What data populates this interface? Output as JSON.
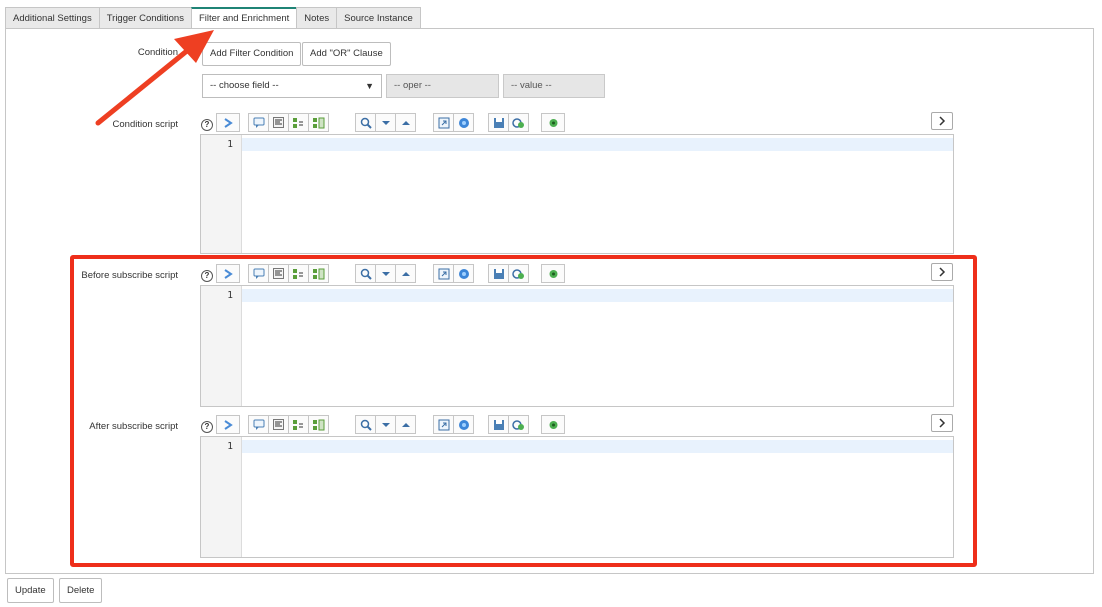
{
  "tabs": [
    {
      "label": "Additional Settings"
    },
    {
      "label": "Trigger Conditions"
    },
    {
      "label": "Filter and Enrichment"
    },
    {
      "label": "Notes"
    },
    {
      "label": "Source Instance"
    }
  ],
  "condition": {
    "label": "Condition",
    "add_filter_label": "Add Filter Condition",
    "add_or_label": "Add \"OR\" Clause",
    "field_select": "-- choose field --",
    "oper": "-- oper --",
    "value": "-- value --"
  },
  "scripts": [
    {
      "label": "Condition script",
      "line": "1"
    },
    {
      "label": "Before subscribe script",
      "line": "1"
    },
    {
      "label": "After subscribe script",
      "line": "1"
    }
  ],
  "help_glyph": "?",
  "toolbar_icons": [
    "format-code-icon",
    "comment-icon",
    "align-icon",
    "replace-icon",
    "replace-all-icon",
    "search-icon",
    "down-icon",
    "up-icon",
    "fullscreen-icon",
    "help-icon",
    "save-icon",
    "syntax-check-icon",
    "debug-icon"
  ],
  "footer": {
    "update_label": "Update",
    "delete_label": "Delete"
  },
  "colors": {
    "highlight_box": "#ee2e1a",
    "arrow": "#ee3f22",
    "active_tab_accent": "#1f8476"
  }
}
